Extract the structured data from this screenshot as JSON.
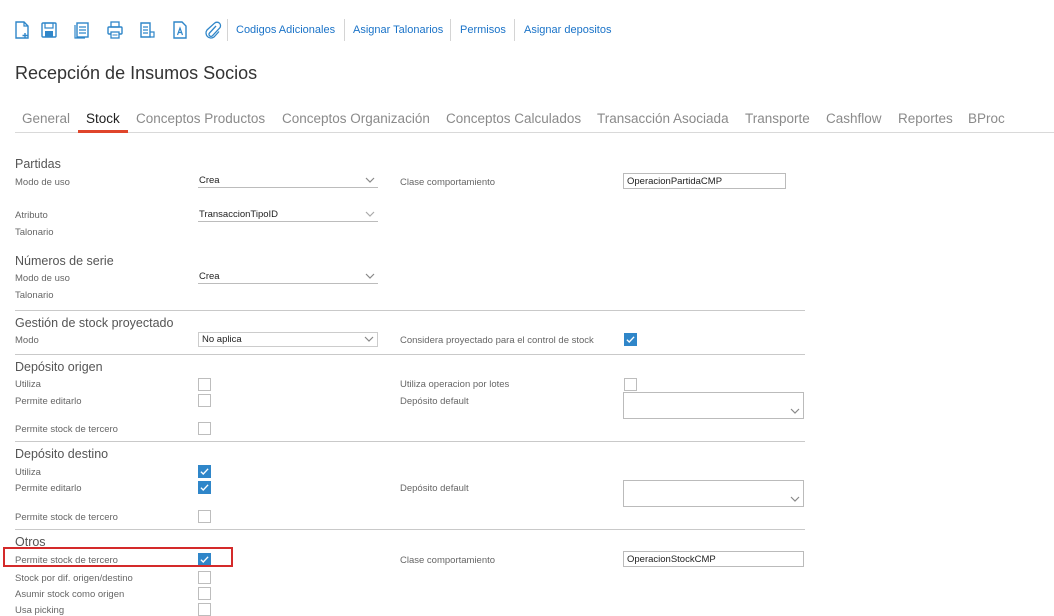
{
  "toolbar": {
    "icons": [
      "new-document-icon",
      "save-icon",
      "copy-document-icon",
      "print-icon",
      "document-list-icon",
      "text-document-icon",
      "paperclip-icon"
    ],
    "links": [
      "Codigos Adicionales",
      "Asignar Talonarios",
      "Permisos",
      "Asignar depositos"
    ]
  },
  "page": {
    "title": "Recepción de Insumos Socios"
  },
  "tabs": [
    "General",
    "Stock",
    "Conceptos Productos",
    "Conceptos Organización",
    "Conceptos Calculados",
    "Transacción Asociada",
    "Transporte",
    "Cashflow",
    "Reportes",
    "BProc"
  ],
  "partidas": {
    "title": "Partidas",
    "modo_label": "Modo de uso",
    "modo_value": "Crea",
    "clase_label": "Clase comportamiento",
    "clase_value": "OperacionPartidaCMP",
    "atributo_label": "Atributo",
    "atributo_value": "TransaccionTipoID",
    "talonario_label": "Talonario"
  },
  "series": {
    "title": "Números de serie",
    "modo_label": "Modo de uso",
    "modo_value": "Crea",
    "talonario_label": "Talonario"
  },
  "proyectado": {
    "title": "Gestión de stock proyectado",
    "modo_label": "Modo",
    "modo_value": "No aplica",
    "considera_label": "Considera proyectado para el control de stock",
    "considera_checked": true
  },
  "origen": {
    "title": "Depósito origen",
    "utiliza_label": "Utiliza",
    "utiliza_checked": false,
    "lotes_label": "Utiliza operacion por lotes",
    "lotes_checked": false,
    "editarlo_label": "Permite editarlo",
    "editarlo_checked": false,
    "default_label": "Depósito default",
    "default_value": "",
    "tercero_label": "Permite stock de tercero",
    "tercero_checked": false
  },
  "destino": {
    "title": "Depósito destino",
    "utiliza_label": "Utiliza",
    "utiliza_checked": true,
    "editarlo_label": "Permite editarlo",
    "editarlo_checked": true,
    "default_label": "Depósito default",
    "default_value": "",
    "tercero_label": "Permite stock de tercero",
    "tercero_checked": false
  },
  "otros": {
    "title": "Otros",
    "tercero_label": "Permite stock de tercero",
    "tercero_checked": true,
    "clase_label": "Clase comportamiento",
    "clase_value": "OperacionStockCMP",
    "dif_label": "Stock por dif. origen/destino",
    "dif_checked": false,
    "asumir_label": "Asumir stock como origen",
    "asumir_checked": false,
    "picking_label": "Usa picking",
    "picking_checked": false
  },
  "colors": {
    "accent": "#1a73c8",
    "tab_underline": "#e0452b",
    "check_on": "#2f86c9",
    "highlight": "#d42a2a"
  }
}
